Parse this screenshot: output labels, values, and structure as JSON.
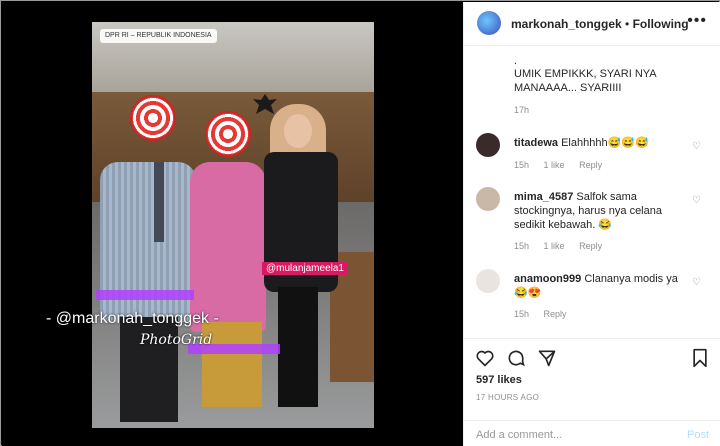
{
  "photo": {
    "location_badge": "DPR RI – REPUBLIK INDONESIA",
    "tag_label": "@mulanjameela1",
    "watermark_user": "- @markonah_tonggek -",
    "watermark_app": "PhotoGrid"
  },
  "header": {
    "username": "markonah_tonggek",
    "separator": "•",
    "follow_status": "Following",
    "more_icon": "more-horizontal-icon"
  },
  "caption": {
    "dot": ".",
    "text": "UMIK EMPIKKK, SYARI NYA MANAAAA... SYARIIII",
    "time": "17h"
  },
  "comments": [
    {
      "username": "titadewa",
      "text": "Elahhhhh😅😅😅",
      "time": "15h",
      "likes": "1 like",
      "reply": "Reply",
      "avatar_color": "#3a2a2a"
    },
    {
      "username": "mima_4587",
      "text": "Salfok sama stockingnya, harus nya celana sedikit kebawah. 😂",
      "time": "15h",
      "likes": "1 like",
      "reply": "Reply",
      "avatar_color": "#c9b8a8"
    },
    {
      "username": "anamoon999",
      "text": "Clananya modis ya 😂😍",
      "time": "15h",
      "likes": "",
      "reply": "Reply",
      "avatar_color": "#e9e4e0"
    }
  ],
  "actions": {
    "like_icon": "heart-icon",
    "comment_icon": "comment-icon",
    "share_icon": "send-icon",
    "save_icon": "bookmark-icon"
  },
  "likes_text": "597 likes",
  "time_ago": "17 HOURS AGO",
  "add_comment": {
    "placeholder": "Add a comment...",
    "post_label": "Post"
  }
}
